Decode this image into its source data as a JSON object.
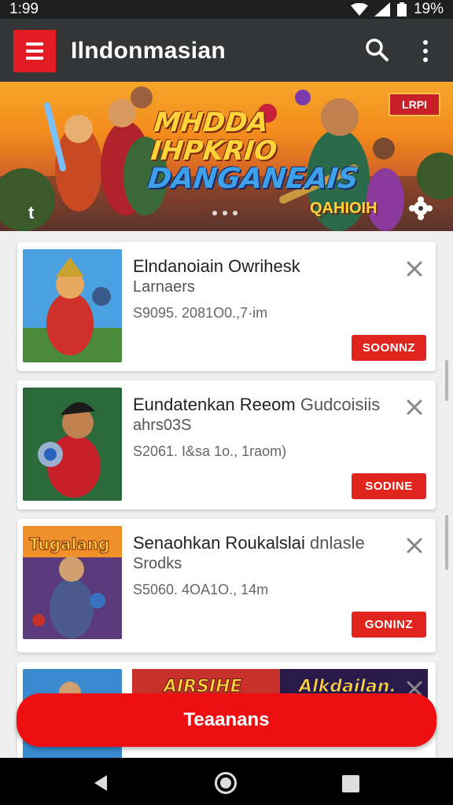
{
  "status_bar": {
    "time": "1:99",
    "battery": "19%"
  },
  "app_bar": {
    "title": "Ilndonmasian",
    "menu_icon": "hamburger-menu-icon",
    "search_icon": "search-icon",
    "more_icon": "more-vert-icon"
  },
  "banner": {
    "title_line1": "MHDDA",
    "title_line2": "IHPKRIO",
    "title_line3": "DANGANEAIS",
    "sub_label": "QAHIOIH",
    "sign_label": "LRPI",
    "left_icon": "t"
  },
  "cards": [
    {
      "title": "Elndanoiain Owrihesk",
      "title_muted": "",
      "subtitle": "Larnaers",
      "meta": "S9095. 2081O0.,7·im",
      "action": "SOONNZ"
    },
    {
      "title": "Eundatenkan Reeom ",
      "title_muted": "Gudcoisiis",
      "subtitle": "ahrs03S",
      "meta": "S2061. I&sa 1o., 1raom)",
      "action": "SODINE"
    },
    {
      "title": "Senaohkan Roukalslai ",
      "title_muted": "dnlasle",
      "subtitle": "Srodks",
      "meta": "S5060. 4OA1O., 14m",
      "action": "GONINZ"
    },
    {
      "title": "",
      "title_muted": "",
      "subtitle": "",
      "meta": "",
      "action": "",
      "promo_text_left": "AIRSIHE",
      "promo_text_right": "Alkdailan."
    }
  ],
  "cta": {
    "label": "Teaanans"
  },
  "colors": {
    "accent": "#e31b23",
    "cta": "#ee0f12",
    "app_bar": "#333537"
  }
}
